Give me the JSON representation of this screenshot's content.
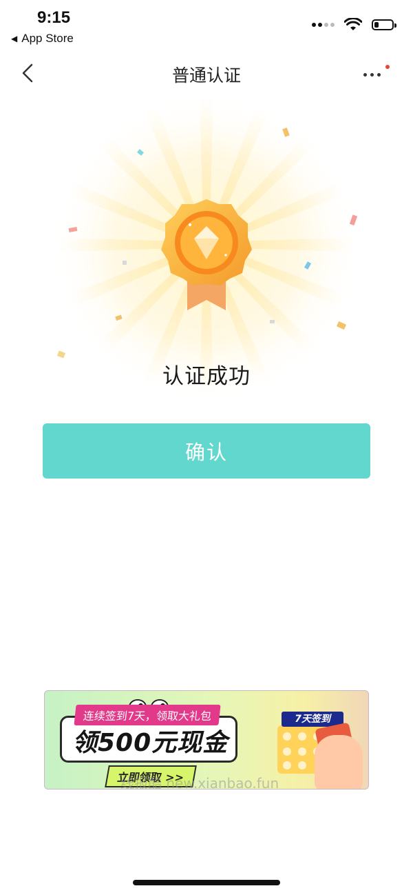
{
  "status_bar": {
    "time": "9:15",
    "back_app": "App Store",
    "battery_level": 0.25
  },
  "nav": {
    "title": "普通认证"
  },
  "result": {
    "message": "认证成功"
  },
  "confirm_button": {
    "label": "确认",
    "color": "#62d7cd"
  },
  "banner": {
    "tag": "连续签到7天，领取大礼包",
    "headline": "领500元现金",
    "cta": "立即领取 >>",
    "calendar_label": "7天签到",
    "watermark": "线报酷 new.xianbao.fun"
  },
  "colors": {
    "accent": "#62d7cd",
    "medal": "#f5a623",
    "unread_dot": "#e8443a"
  }
}
